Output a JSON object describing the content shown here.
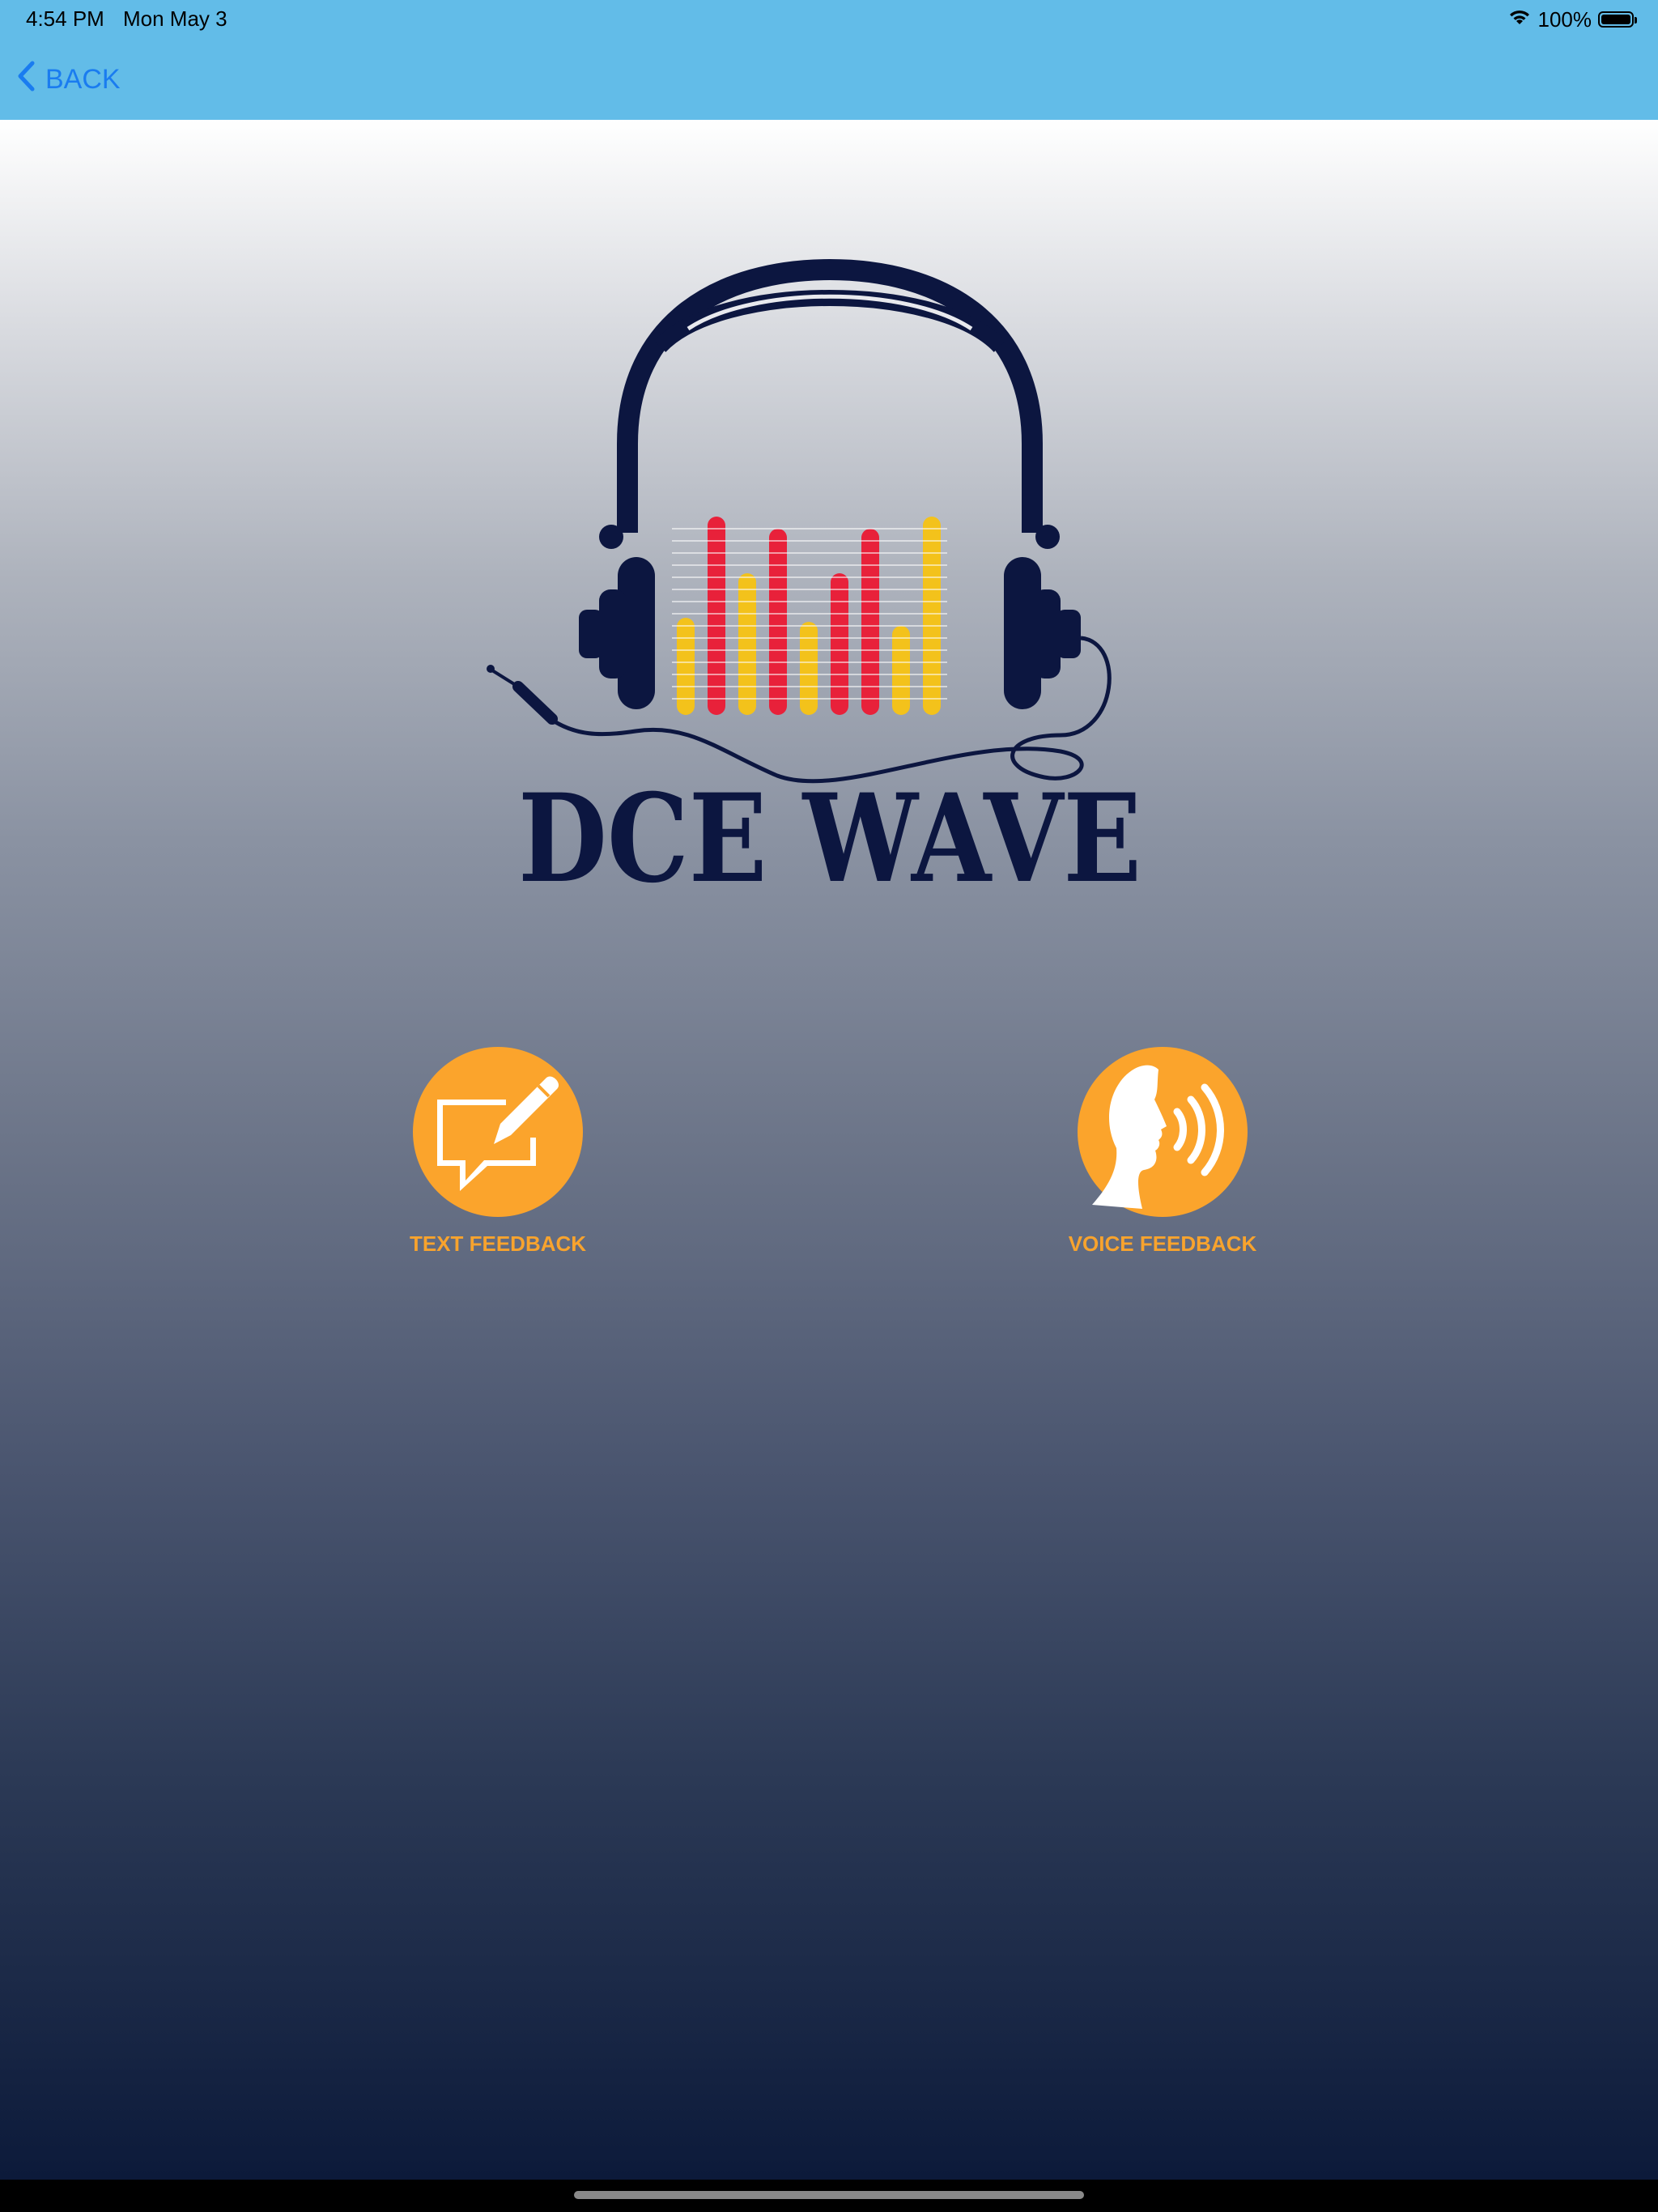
{
  "status_bar": {
    "time": "4:54 PM",
    "date": "Mon May 3",
    "battery_percent": "100%",
    "battery_level": 1.0,
    "icons": [
      "wifi-icon",
      "battery-icon"
    ]
  },
  "nav": {
    "back_label": "BACK",
    "back_icon": "chevron-left-icon"
  },
  "logo": {
    "brand_text": "DCE WAVE",
    "icon": "headphones-equalizer-logo"
  },
  "actions": {
    "text_feedback": {
      "label": "TEXT FEEDBACK",
      "icon": "chat-pencil-icon"
    },
    "voice_feedback": {
      "label": "VOICE FEEDBACK",
      "icon": "speaking-head-icon"
    }
  },
  "colors": {
    "nav_bar": "#62bce8",
    "back_link": "#1a7cf0",
    "accent_orange": "#fba42c",
    "logo_navy": "#0c1640",
    "eq_red": "#e8213a",
    "eq_yellow": "#f3c21b"
  }
}
